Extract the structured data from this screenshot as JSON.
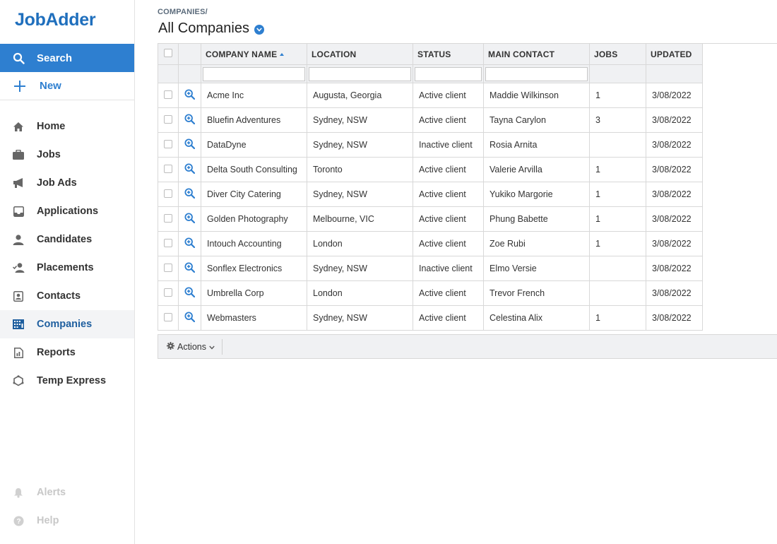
{
  "app": {
    "logo": "JobAdder"
  },
  "sidebar": {
    "search_label": "Search",
    "new_label": "New",
    "items": [
      {
        "label": "Home",
        "icon": "home-icon"
      },
      {
        "label": "Jobs",
        "icon": "briefcase-icon"
      },
      {
        "label": "Job Ads",
        "icon": "megaphone-icon"
      },
      {
        "label": "Applications",
        "icon": "inbox-icon"
      },
      {
        "label": "Candidates",
        "icon": "person-icon"
      },
      {
        "label": "Placements",
        "icon": "person-check-icon"
      },
      {
        "label": "Contacts",
        "icon": "contact-card-icon"
      },
      {
        "label": "Companies",
        "icon": "building-icon",
        "active": true
      },
      {
        "label": "Reports",
        "icon": "report-icon"
      },
      {
        "label": "Temp Express",
        "icon": "temp-express-icon"
      }
    ],
    "footer": [
      {
        "label": "Alerts",
        "icon": "bell-icon"
      },
      {
        "label": "Help",
        "icon": "help-icon"
      }
    ]
  },
  "header": {
    "breadcrumb": "COMPANIES/",
    "title": "All Companies"
  },
  "table": {
    "columns": [
      "COMPANY NAME",
      "LOCATION",
      "STATUS",
      "MAIN CONTACT",
      "JOBS",
      "UPDATED"
    ],
    "sort_column": "COMPANY NAME",
    "sort_direction": "ascending",
    "rows": [
      {
        "company": "Acme Inc",
        "location": "Augusta, Georgia",
        "status": "Active client",
        "contact": "Maddie Wilkinson",
        "jobs": "1",
        "updated": "3/08/2022"
      },
      {
        "company": "Bluefin Adventures",
        "location": "Sydney, NSW",
        "status": "Active client",
        "contact": "Tayna Carylon",
        "jobs": "3",
        "updated": "3/08/2022"
      },
      {
        "company": "DataDyne",
        "location": "Sydney, NSW",
        "status": "Inactive client",
        "contact": "Rosia Arnita",
        "jobs": "",
        "updated": "3/08/2022"
      },
      {
        "company": "Delta South Consulting",
        "location": "Toronto",
        "status": "Active client",
        "contact": "Valerie Arvilla",
        "jobs": "1",
        "updated": "3/08/2022"
      },
      {
        "company": "Diver City Catering",
        "location": "Sydney, NSW",
        "status": "Active client",
        "contact": "Yukiko Margorie",
        "jobs": "1",
        "updated": "3/08/2022"
      },
      {
        "company": "Golden Photography",
        "location": "Melbourne, VIC",
        "status": "Active client",
        "contact": "Phung Babette",
        "jobs": "1",
        "updated": "3/08/2022"
      },
      {
        "company": "Intouch Accounting",
        "location": "London",
        "status": "Active client",
        "contact": "Zoe Rubi",
        "jobs": "1",
        "updated": "3/08/2022"
      },
      {
        "company": "Sonflex Electronics",
        "location": "Sydney, NSW",
        "status": "Inactive client",
        "contact": "Elmo Versie",
        "jobs": "",
        "updated": "3/08/2022"
      },
      {
        "company": "Umbrella Corp",
        "location": "London",
        "status": "Active client",
        "contact": "Trevor French",
        "jobs": "",
        "updated": "3/08/2022"
      },
      {
        "company": "Webmasters",
        "location": "Sydney, NSW",
        "status": "Active client",
        "contact": "Celestina Alix",
        "jobs": "1",
        "updated": "3/08/2022"
      }
    ]
  },
  "actions": {
    "label": "Actions"
  },
  "colors": {
    "accent": "#2e7fd0",
    "logo": "#1f6fbd",
    "header_bg": "#f0f1f3",
    "active_nav_bg": "#f3f4f6"
  }
}
